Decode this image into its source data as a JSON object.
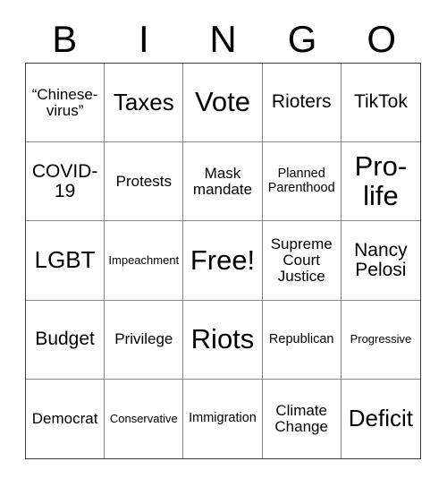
{
  "card": {
    "header_letters": [
      "B",
      "I",
      "N",
      "G",
      "O"
    ],
    "grid_line_color": "#888888",
    "border_color": "#3a3a3a",
    "cell_background": "#ffffff",
    "text_color": "#000000",
    "rows": 5,
    "columns": 5,
    "cells": [
      {
        "text": "“Chinese-virus”",
        "size": "fs-sm"
      },
      {
        "text": "Taxes",
        "size": "fs-lg"
      },
      {
        "text": "Vote",
        "size": "fs-xl"
      },
      {
        "text": "Rioters",
        "size": "fs-md"
      },
      {
        "text": "TikTok",
        "size": "fs-md"
      },
      {
        "text": "COVID-19",
        "size": "fs-md"
      },
      {
        "text": "Protests",
        "size": "fs-sm"
      },
      {
        "text": "Mask mandate",
        "size": "fs-sm"
      },
      {
        "text": "Planned Parenthood",
        "size": "fs-xs"
      },
      {
        "text": "Pro-life",
        "size": "fs-xl"
      },
      {
        "text": "LGBT",
        "size": "fs-lg"
      },
      {
        "text": "Impeachment",
        "size": "fs-xxs"
      },
      {
        "text": "Free!",
        "size": "fs-xl"
      },
      {
        "text": "Supreme Court Justice",
        "size": "fs-sm"
      },
      {
        "text": "Nancy Pelosi",
        "size": "fs-md"
      },
      {
        "text": "Budget",
        "size": "fs-md"
      },
      {
        "text": "Privilege",
        "size": "fs-sm"
      },
      {
        "text": "Riots",
        "size": "fs-xl"
      },
      {
        "text": "Republican",
        "size": "fs-xs"
      },
      {
        "text": "Progressive",
        "size": "fs-xxs"
      },
      {
        "text": "Democrat",
        "size": "fs-sm"
      },
      {
        "text": "Conservative",
        "size": "fs-xxs"
      },
      {
        "text": "Immigration",
        "size": "fs-xs"
      },
      {
        "text": "Climate Change",
        "size": "fs-sm"
      },
      {
        "text": "Deficit",
        "size": "fs-lg"
      }
    ]
  }
}
